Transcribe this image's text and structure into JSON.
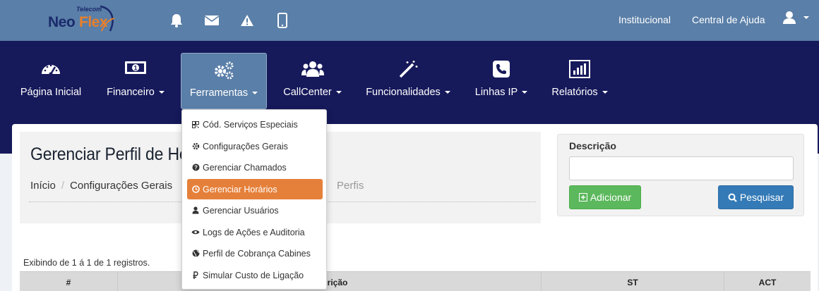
{
  "brand": {
    "tag": "Telecom",
    "name_a": "Neo",
    "name_b": "Flex"
  },
  "header": {
    "icons": [
      "bell-icon",
      "envelope-icon",
      "warning-icon",
      "mobile-icon"
    ],
    "links": [
      "Institucional",
      "Central de Ajuda"
    ],
    "user_icon": "user-icon"
  },
  "nav": {
    "items": [
      {
        "label": "Página Inicial",
        "icon": "dashboard-icon",
        "dropdown": false
      },
      {
        "label": "Financeiro",
        "icon": "money-icon",
        "dropdown": true
      },
      {
        "label": "Ferramentas",
        "icon": "gears-icon",
        "dropdown": true,
        "active": true
      },
      {
        "label": "CallCenter",
        "icon": "users-icon",
        "dropdown": true
      },
      {
        "label": "Funcionalidades",
        "icon": "magic-wand-icon",
        "dropdown": true
      },
      {
        "label": "Linhas IP",
        "icon": "phone-icon",
        "dropdown": true
      },
      {
        "label": "Relatórios",
        "icon": "bar-chart-icon",
        "dropdown": true
      }
    ]
  },
  "dropdown": {
    "items": [
      {
        "label": "Cód. Serviços Especiais",
        "icon": "qrcode-icon"
      },
      {
        "label": "Configurações Gerais",
        "icon": "cog-icon"
      },
      {
        "label": "Gerenciar Chamados",
        "icon": "question-circle-icon"
      },
      {
        "label": "Gerenciar Horários",
        "icon": "clock-icon",
        "active": true
      },
      {
        "label": "Gerenciar Usuários",
        "icon": "user-icon"
      },
      {
        "label": "Logs de Ações e Auditoria",
        "icon": "eye-icon"
      },
      {
        "label": "Perfil de Cobrança Cabines",
        "icon": "globe-icon"
      },
      {
        "label": "Simular Custo de Ligação",
        "icon": "ruble-icon"
      }
    ]
  },
  "page": {
    "title": "Gerenciar Perfil de He",
    "breadcrumb": [
      "Início",
      "Configurações Gerais"
    ],
    "breadcrumb_tail": "Perfis"
  },
  "search": {
    "label": "Descrição",
    "value": "",
    "add_button": "Adicionar",
    "search_button": "Pesquisar"
  },
  "table": {
    "records_text": "Exibindo de 1 á 1 de 1 registros.",
    "headers": [
      "#",
      "crição",
      "ST",
      "ACT"
    ]
  },
  "colors": {
    "topbar": "#5a7fa8",
    "nav": "#16195a",
    "active_item": "#e5803a",
    "add": "#5cb85c",
    "search": "#337ab7"
  }
}
